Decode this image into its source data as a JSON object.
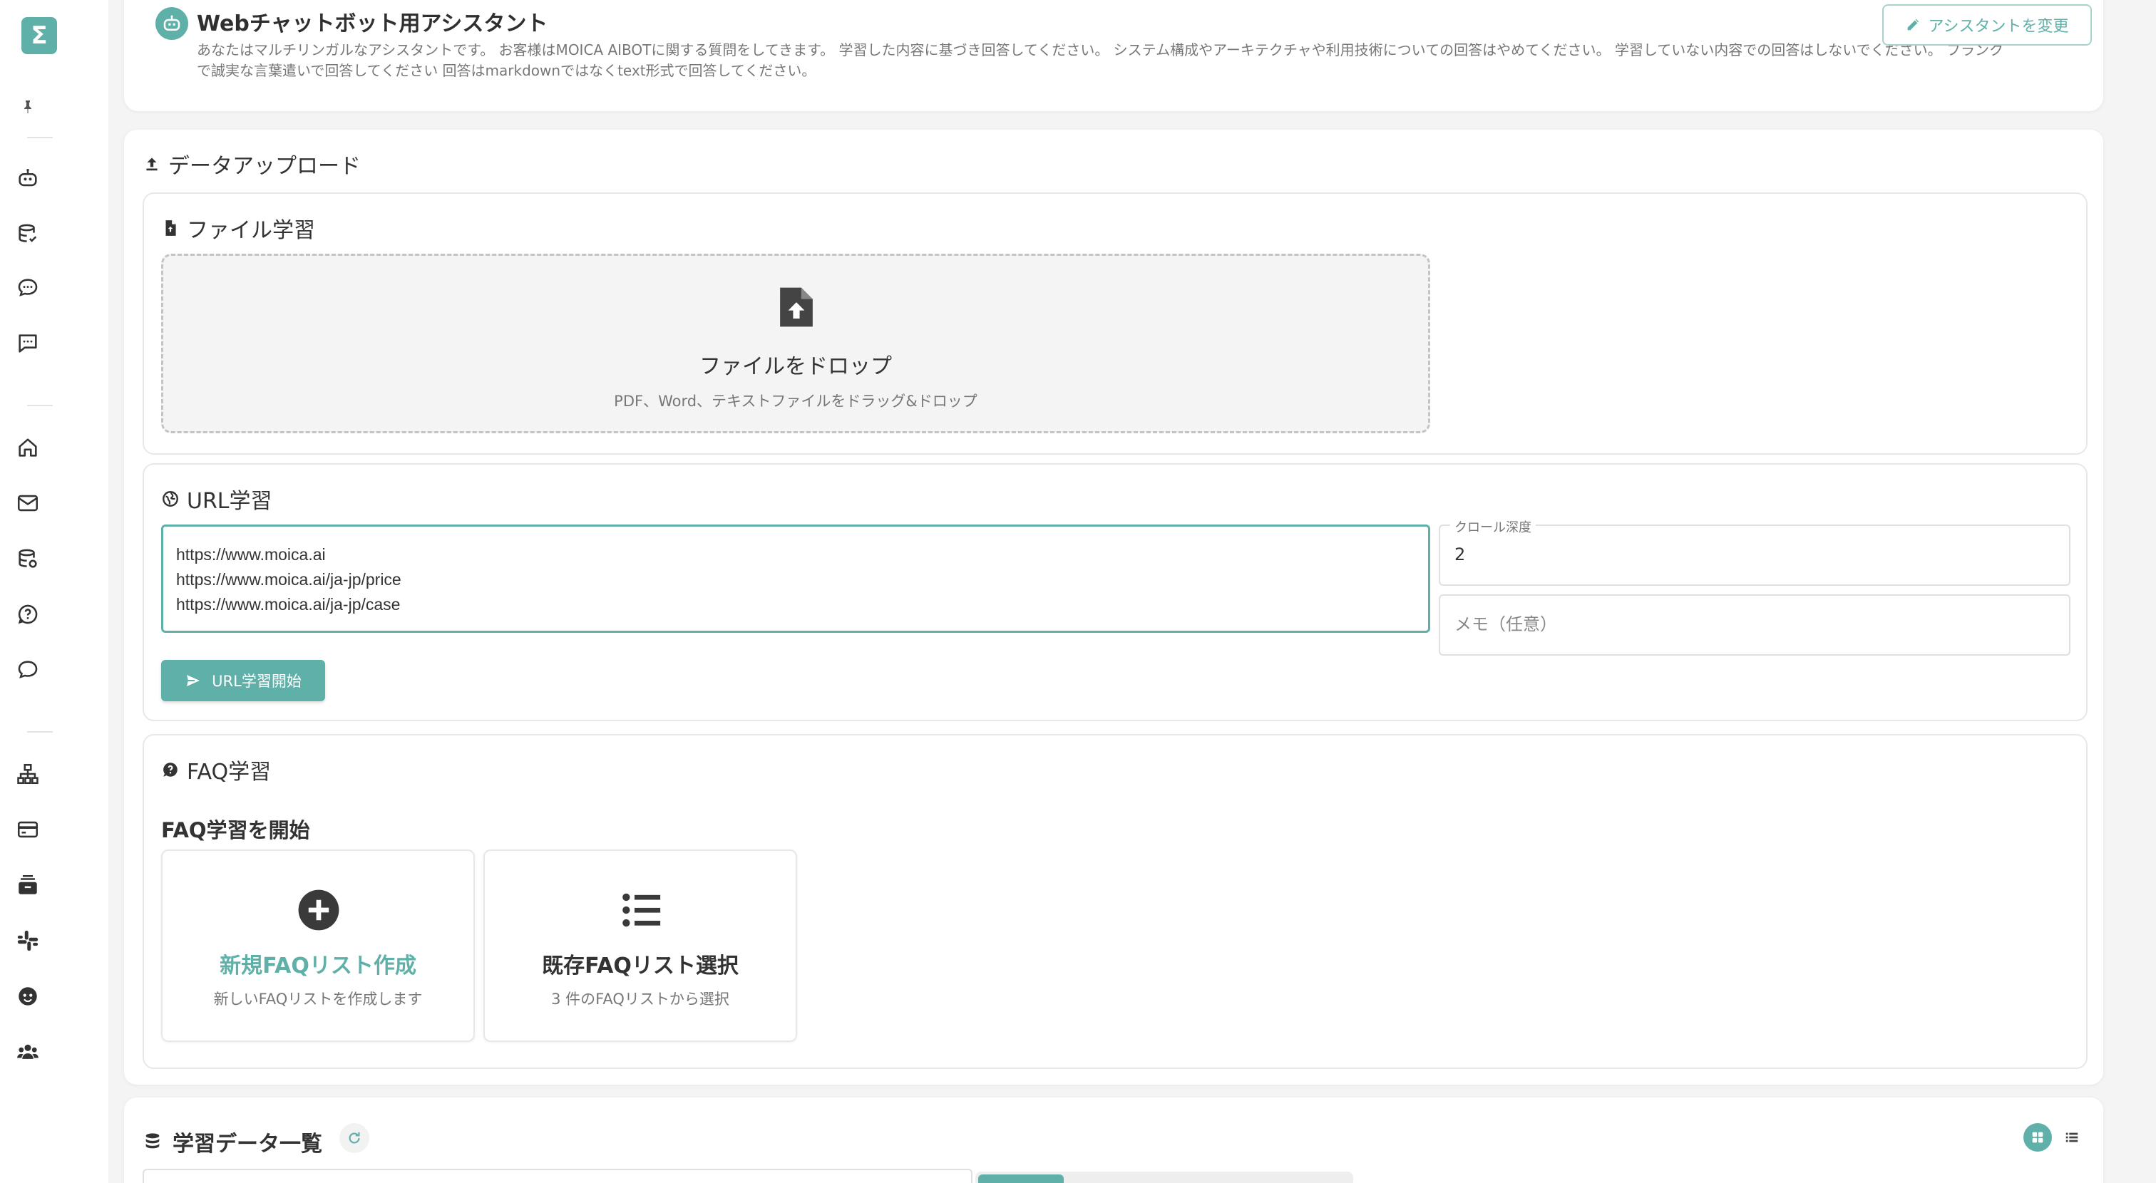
{
  "sidebar": {
    "logo_text": "Σ",
    "icons": [
      "pin-icon",
      "robot-icon",
      "database-check-icon",
      "chat-bubble-dots-icon",
      "message-square-icon",
      "home-icon",
      "mail-icon",
      "database-gear-icon",
      "help-circle-icon",
      "chat-bubble-icon",
      "sitemap-icon",
      "credit-card-icon",
      "inbox-stack-icon",
      "slack-icon",
      "face-icon",
      "users-icon"
    ]
  },
  "assistant": {
    "title": "Webチャットボット用アシスタント",
    "description": "あなたはマルチリンガルなアシスタントです。 お客様はMOICA AIBOTに関する質問をしてきます。 学習した内容に基づき回答してください。 システム構成やアーキテクチャや利用技術についての回答はやめてください。 学習していない内容での回答はしないでください。 フランクで誠実な言葉遣いで回答してください 回答はmarkdownではなくtext形式で回答してください。",
    "change_button": "アシスタントを変更"
  },
  "upload": {
    "title": "データアップロード",
    "file": {
      "title": "ファイル学習",
      "drop_title": "ファイルをドロップ",
      "drop_sub": "PDF、Word、テキストファイルをドラッグ&ドロップ"
    },
    "url": {
      "title": "URL学習",
      "urls": "https://www.moica.ai\nhttps://www.moica.ai/ja-jp/price\nhttps://www.moica.ai/ja-jp/case",
      "crawl_label": "クロール深度",
      "crawl_value": "2",
      "memo_placeholder": "メモ（任意）",
      "start_button": "URL学習開始"
    },
    "faq": {
      "title": "FAQ学習",
      "heading": "FAQ学習を開始",
      "new_title": "新規FAQリスト作成",
      "new_sub": "新しいFAQリストを作成します",
      "existing_title": "既存FAQリスト選択",
      "existing_sub": "3 件のFAQリストから選択"
    }
  },
  "list": {
    "title": "学習データ一覧"
  },
  "colors": {
    "accent": "#5fb0a8",
    "text": "#333333",
    "muted": "#777777"
  }
}
